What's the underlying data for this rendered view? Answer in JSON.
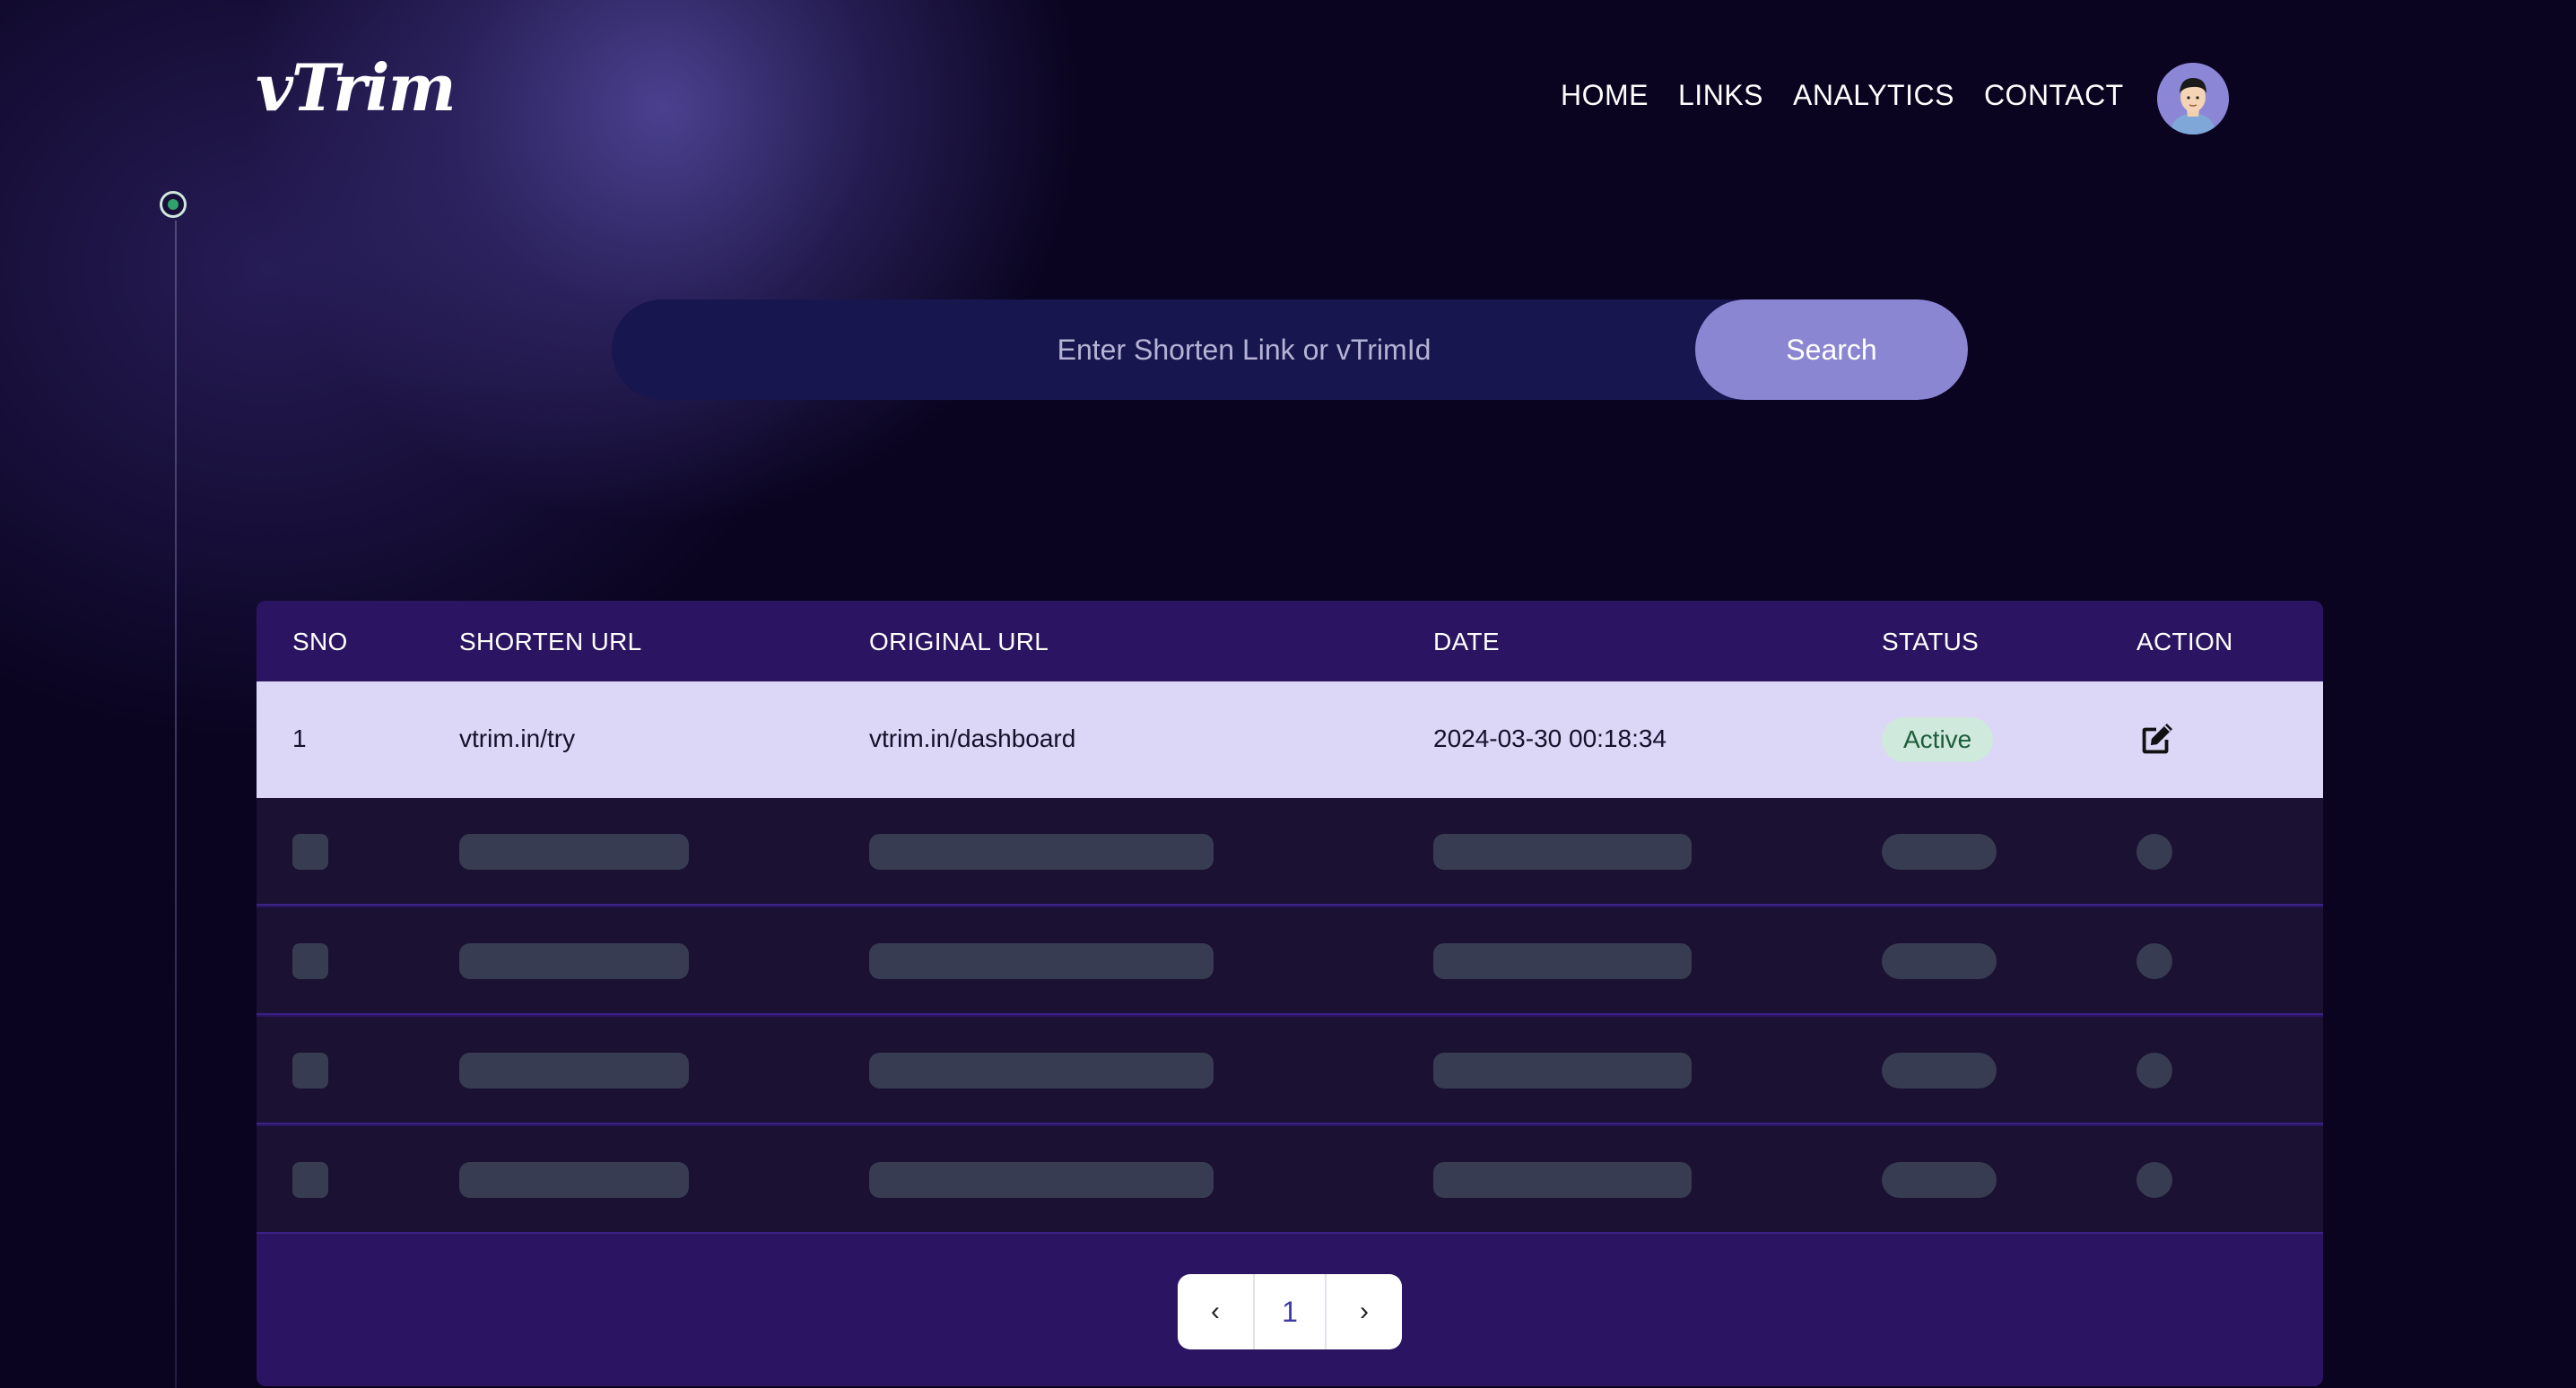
{
  "header": {
    "logo": "vTrim",
    "nav": [
      "HOME",
      "LINKS",
      "ANALYTICS",
      "CONTACT"
    ]
  },
  "search": {
    "placeholder": "Enter Shorten Link or vTrimId",
    "button_label": "Search"
  },
  "table": {
    "columns": [
      "SNO",
      "SHORTEN URL",
      "ORIGINAL URL",
      "DATE",
      "STATUS",
      "ACTION"
    ],
    "rows": [
      {
        "sno": "1",
        "shorten_url": "vtrim.in/try",
        "original_url": "vtrim.in/dashboard",
        "date": "2024-03-30 00:18:34",
        "status": "Active"
      }
    ],
    "skeleton_row_count": 4
  },
  "pagination": {
    "prev": "‹",
    "current_page": "1",
    "next": "›"
  },
  "icons": {
    "edit": "edit-icon",
    "avatar": "user-avatar"
  },
  "colors": {
    "accent": "#8a86d2",
    "table_header": "#2b1461",
    "row_highlight": "#dcd6f7",
    "status_active_bg": "#cfe9dc",
    "status_active_text": "#1c5c3a"
  }
}
